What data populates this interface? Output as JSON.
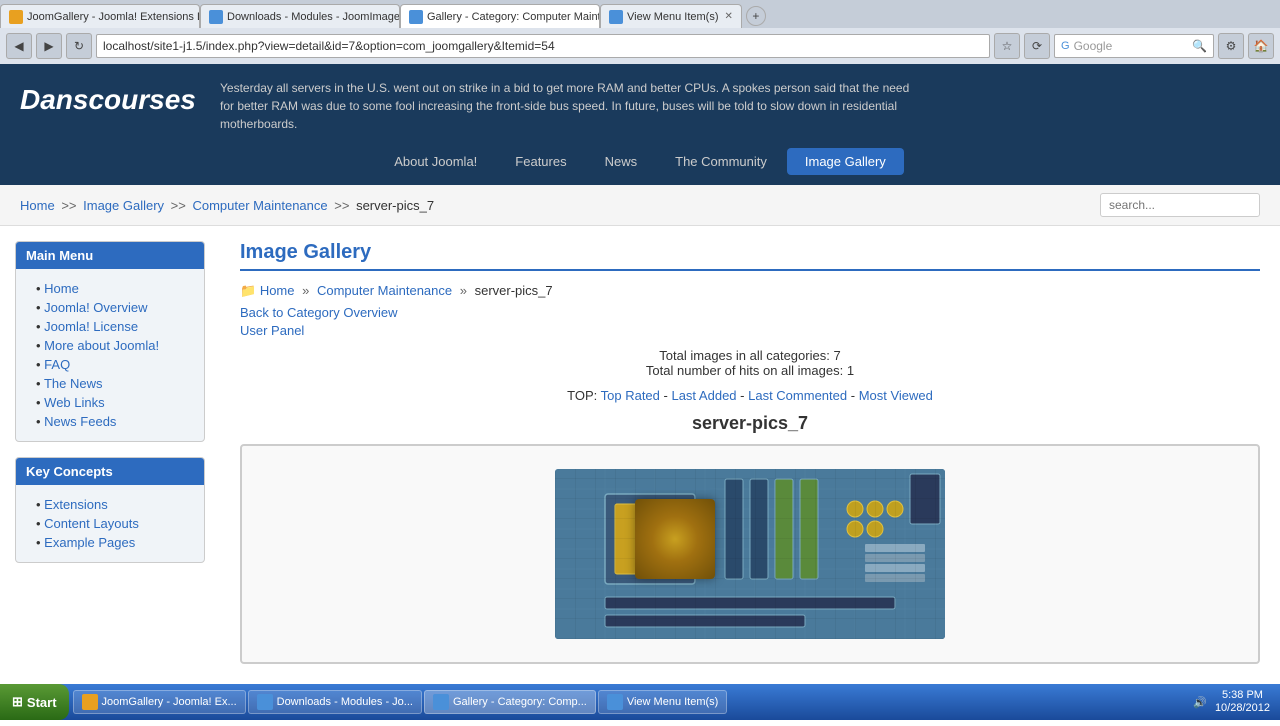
{
  "browser": {
    "tabs": [
      {
        "label": "JoomGallery - Joomla! Extensions Directory",
        "active": false,
        "icon_color": "#e8a020"
      },
      {
        "label": "Downloads - Modules - JoomImages",
        "active": false,
        "icon_color": "#4a90d9"
      },
      {
        "label": "Gallery - Category: Computer Maintena...",
        "active": true,
        "icon_color": "#4a90d9"
      },
      {
        "label": "View Menu Item(s)",
        "active": false,
        "icon_color": "#4a90d9"
      }
    ],
    "address": "localhost/site1-j1.5/index.php?view=detail&id=7&option=com_joomgallery&Itemid=54",
    "search_placeholder": "Google"
  },
  "site": {
    "logo": "Danscourses",
    "header_news": "Yesterday all servers in the U.S. went out on strike in a bid to get more RAM and better CPUs. A spokes person said that the need for better RAM was due to some fool increasing the front-side bus speed. In future, buses will be told to slow down in residential motherboards."
  },
  "nav": {
    "items": [
      {
        "label": "About Joomla!",
        "active": false
      },
      {
        "label": "Features",
        "active": false
      },
      {
        "label": "News",
        "active": false
      },
      {
        "label": "The Community",
        "active": false
      },
      {
        "label": "Image Gallery",
        "active": true
      }
    ]
  },
  "breadcrumb": {
    "items": [
      {
        "label": "Home",
        "href": "#"
      },
      {
        "label": "Image Gallery",
        "href": "#"
      },
      {
        "label": "Computer Maintenance",
        "href": "#"
      },
      {
        "label": "server-pics_7",
        "href": "#"
      }
    ],
    "search_placeholder": "search..."
  },
  "sidebar": {
    "main_menu": {
      "title": "Main Menu",
      "items": [
        {
          "label": "Home"
        },
        {
          "label": "Joomla! Overview"
        },
        {
          "label": "Joomla! License"
        },
        {
          "label": "More about Joomla!"
        },
        {
          "label": "FAQ"
        },
        {
          "label": "The News"
        },
        {
          "label": "Web Links"
        },
        {
          "label": "News Feeds"
        }
      ]
    },
    "key_concepts": {
      "title": "Key Concepts",
      "items": [
        {
          "label": "Extensions"
        },
        {
          "label": "Content Layouts"
        },
        {
          "label": "Example Pages"
        }
      ]
    }
  },
  "content": {
    "title": "Image Gallery",
    "breadcrumb": {
      "home": "Home",
      "category": "Computer Maintenance",
      "current": "server-pics_7"
    },
    "back_link": "Back to Category Overview",
    "user_panel": "User Panel",
    "stats": {
      "total_images_label": "Total images in all categories:",
      "total_images_value": "7",
      "total_hits_label": "Total number of hits on all images:",
      "total_hits_value": "1"
    },
    "top_links": {
      "prefix": "TOP:",
      "links": [
        "Top Rated",
        "Last Added",
        "Last Commented",
        "Most Viewed"
      ],
      "separators": [
        " - ",
        " - ",
        " - "
      ]
    },
    "gallery_title": "server-pics_7"
  },
  "taskbar": {
    "start_label": "Start",
    "items": [
      {
        "label": "JoomGallery - Joomla! Ex...",
        "color": "#e8a020"
      },
      {
        "label": "Downloads - Modules - Jo...",
        "color": "#4a90d9"
      },
      {
        "label": "Gallery - Category: Comp...",
        "color": "#4a90d9"
      },
      {
        "label": "View Menu Item(s)",
        "color": "#4a90d9"
      }
    ],
    "time": "5:38 PM",
    "date": "10/28/2012"
  }
}
